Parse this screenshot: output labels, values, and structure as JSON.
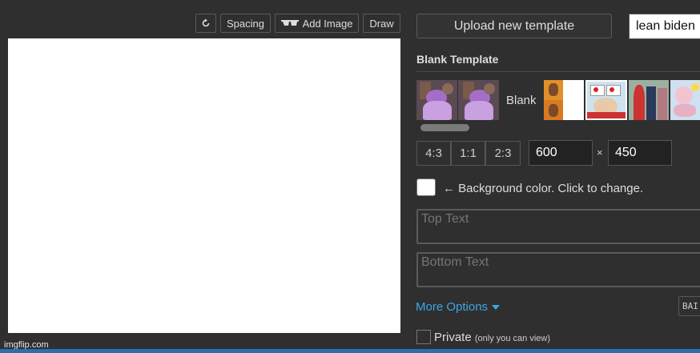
{
  "toolbar": {
    "spacing_label": "Spacing",
    "add_image_label": "Add Image",
    "draw_label": "Draw"
  },
  "canvas": {
    "watermark": "imgflip.com"
  },
  "sidebar": {
    "upload_label": "Upload new template",
    "search_value": "lean biden",
    "template_title": "Blank Template",
    "blank_label": "Blank",
    "ratios": [
      "4:3",
      "1:1",
      "2:3"
    ],
    "width_value": "600",
    "height_value": "450",
    "times_symbol": "×",
    "bg_label": "← Background color. Click to change.",
    "top_text_placeholder": "Top Text",
    "bottom_text_placeholder": "Bottom Text",
    "more_options_label": "More Options",
    "font_button_label": "BAI",
    "private_label": "Private",
    "private_sub": "(only you can view)"
  },
  "colors": {
    "background": "#2f2f2f",
    "canvas": "#ffffff",
    "link": "#3ea6e6"
  },
  "icons": [
    "rotate-icon",
    "sunglasses-icon",
    "caret-down-icon"
  ]
}
